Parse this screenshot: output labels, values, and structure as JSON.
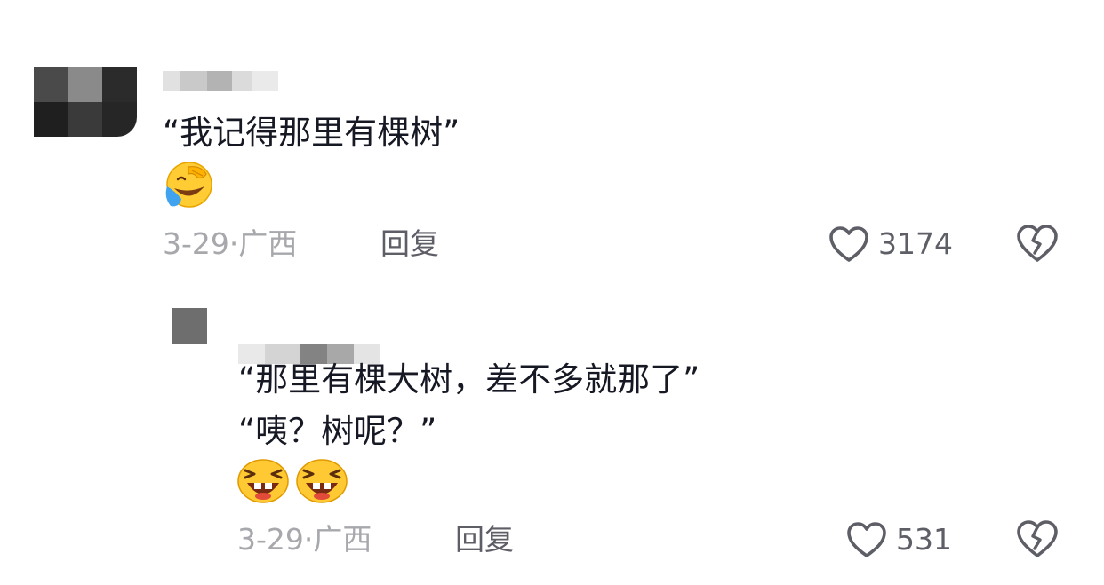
{
  "comments": [
    {
      "text": "“我记得那里有棵树”",
      "emojis": [
        "facepalm-crying-laugh-icon"
      ],
      "date": "3-29",
      "separator": "·",
      "location": "广西",
      "reply_label": "回复",
      "likes": "3174"
    },
    {
      "text_line1": "“那里有棵大树，差不多就那了”",
      "text_line2": "“咦？树呢？”",
      "emojis": [
        "grinning-laugh-icon",
        "grinning-laugh-icon"
      ],
      "date": "3-29",
      "separator": "·",
      "location": "广西",
      "reply_label": "回复",
      "likes": "531"
    }
  ],
  "colors": {
    "text": "#161823",
    "meta": "#a7a8ac",
    "secondary": "#5d5e66"
  }
}
